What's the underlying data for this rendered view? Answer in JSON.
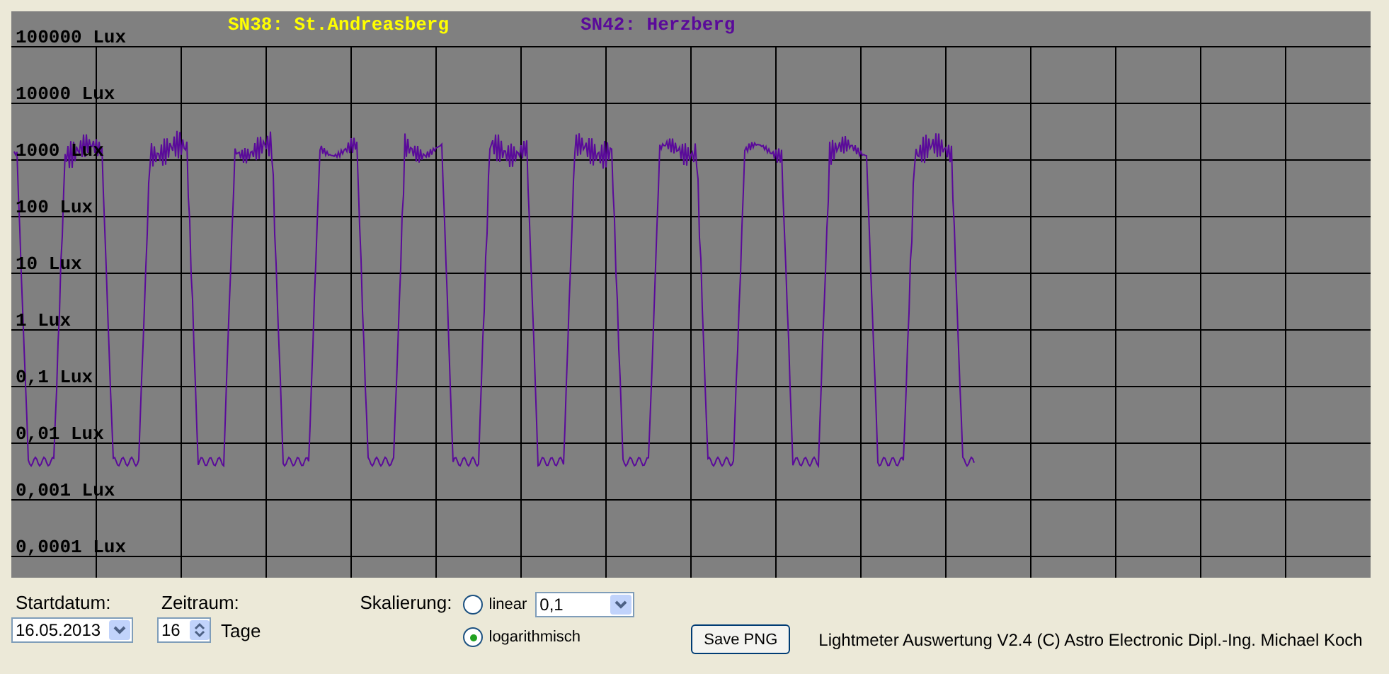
{
  "chart": {
    "legend": [
      {
        "label": "SN38: St.Andreasberg",
        "color": "#ffff00"
      },
      {
        "label": "SN42: Herzberg",
        "color": "#5a0a9a"
      }
    ],
    "y_labels": [
      "100000 Lux",
      "10000 Lux",
      "1000 Lux",
      "100 Lux",
      "10 Lux",
      "1 Lux",
      "0,1 Lux",
      "0,01 Lux",
      "0,001 Lux",
      "0,0001 Lux"
    ]
  },
  "controls": {
    "start_date": {
      "label": "Startdatum:",
      "value": "16.05.2013"
    },
    "period": {
      "label": "Zeitraum:",
      "value": "16",
      "unit": "Tage"
    },
    "scaling": {
      "label": "Skalierung:",
      "options": [
        {
          "label": "linear",
          "selected": false
        },
        {
          "label": "logarithmisch",
          "selected": true
        }
      ],
      "linear_value": "0,1"
    },
    "save_button": "Save PNG",
    "credit": "Lightmeter Auswertung V2.4  (C) Astro Electronic Dipl.-Ing. Michael Koch"
  }
}
